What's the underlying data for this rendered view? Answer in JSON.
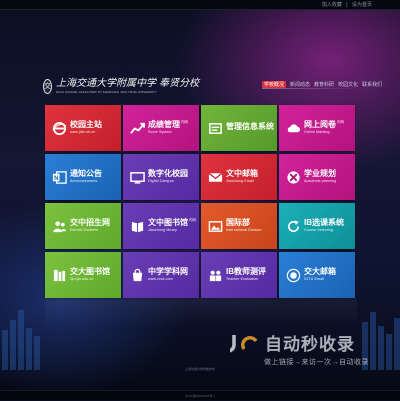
{
  "topbar": {
    "links": [
      "加入收藏",
      "|",
      "设为首页"
    ]
  },
  "header": {
    "logo_main": "上海交通大学附属中学 奉贤分校",
    "logo_sub": "HIGH SCHOOL AFFILIATED TO SHANGHAI JIAO TONG UNIVERSITY",
    "crest_glyph": "交"
  },
  "nav": {
    "items": [
      "学校概况",
      "新闻动态",
      "教育科研",
      "校园文化",
      "联系我们"
    ],
    "active_index": 0
  },
  "tiles": [
    {
      "title": "校园主站",
      "badge": "",
      "subtitle": "www.jdfz.sh.cn",
      "color": "red",
      "icon": "ie-icon"
    },
    {
      "title": "成绩管理",
      "badge": "内网",
      "subtitle": "Score System",
      "color": "pink",
      "icon": "chart-icon"
    },
    {
      "title": "管理信息系统",
      "badge": "",
      "subtitle": "",
      "color": "green",
      "icon": "folder-icon"
    },
    {
      "title": "网上阅卷",
      "badge": "内网",
      "subtitle": "Online Marking",
      "color": "pink",
      "icon": "cloud-icon"
    },
    {
      "title": "通知公告",
      "badge": "",
      "subtitle": "Announcements",
      "color": "blue",
      "icon": "onenote-icon"
    },
    {
      "title": "数字化校园",
      "badge": "",
      "subtitle": "Digital Campus",
      "color": "purple",
      "icon": "monitor-icon"
    },
    {
      "title": "文中邮箱",
      "badge": "",
      "subtitle": "Jiaozhong Email",
      "color": "red",
      "icon": "mail-icon"
    },
    {
      "title": "学业规划",
      "badge": "",
      "subtitle": "Academic planning",
      "color": "pink",
      "icon": "xbox-icon"
    },
    {
      "title": "交中招生网",
      "badge": "",
      "subtitle": "Recruit Students",
      "color": "lgreen",
      "icon": "people-icon"
    },
    {
      "title": "文中图书馆",
      "badge": "内网",
      "subtitle": "Jiaozhong library",
      "color": "purple",
      "icon": "book-icon"
    },
    {
      "title": "国际部",
      "badge": "",
      "subtitle": "International Division",
      "color": "orange",
      "icon": "photo-icon"
    },
    {
      "title": "IB选课系统",
      "badge": "",
      "subtitle": "Course Selecting",
      "color": "teal",
      "icon": "refresh-icon"
    },
    {
      "title": "交大图书馆",
      "badge": "",
      "subtitle": "lib.sjtu.edu.cn",
      "color": "lgreen",
      "icon": "library-icon"
    },
    {
      "title": "中学学科网",
      "badge": "",
      "subtitle": "www.zxxk.com",
      "color": "purple",
      "icon": "store-icon"
    },
    {
      "title": "IB教师测评",
      "badge": "",
      "subtitle": "Teacher Evaluation",
      "color": "purple",
      "icon": "users-icon"
    },
    {
      "title": "交大邮箱",
      "badge": "",
      "subtitle": "SJTU Email",
      "color": "blue",
      "icon": "seal-icon"
    }
  ],
  "watermark": {
    "title": "自动秒收录",
    "subtitle": "做上链接→来访一次→自动收录"
  },
  "footer": {
    "copyright": "沪ICP备05003345号-1",
    "info": "上海交通大学附属中学"
  }
}
